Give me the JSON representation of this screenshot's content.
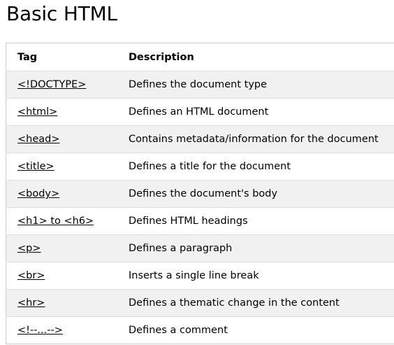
{
  "page": {
    "title": "Basic HTML"
  },
  "table": {
    "headers": {
      "tag": "Tag",
      "description": "Description"
    },
    "rows": [
      {
        "tag": "<!DOCTYPE>",
        "description": "Defines the document type"
      },
      {
        "tag": "<html>",
        "description": "Defines an HTML document"
      },
      {
        "tag": "<head>",
        "description": "Contains metadata/information for the document"
      },
      {
        "tag": "<title>",
        "description": "Defines a title for the document"
      },
      {
        "tag": "<body>",
        "description": "Defines the document's body"
      },
      {
        "tag": "<h1> to <h6>",
        "description": "Defines HTML headings"
      },
      {
        "tag": "<p>",
        "description": "Defines a paragraph"
      },
      {
        "tag": "<br>",
        "description": "Inserts a single line break"
      },
      {
        "tag": "<hr>",
        "description": "Defines a thematic change in the content"
      },
      {
        "tag": "<!--...-->",
        "description": "Defines a comment"
      }
    ]
  },
  "colors": {
    "row_alt_background": "#f1f1f1",
    "border": "#cccccc",
    "text": "#000000"
  }
}
